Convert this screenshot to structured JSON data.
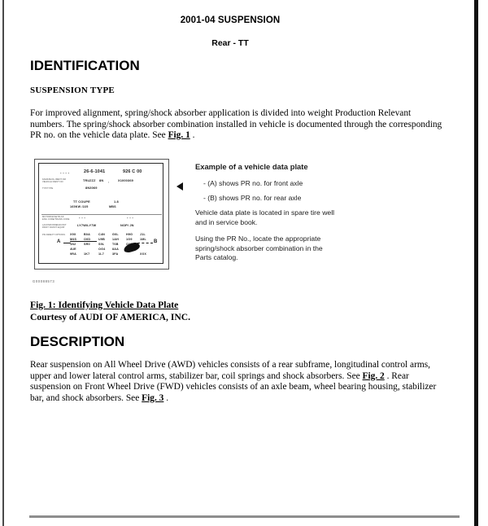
{
  "header": {
    "title": "2001-04 SUSPENSION",
    "subtitle": "Rear - TT"
  },
  "sections": {
    "identification": {
      "heading": "IDENTIFICATION",
      "subheading": "SUSPENSION TYPE",
      "body_1": "For improved alignment, spring/shock absorber application is divided into weight Production Relevant",
      "body_2": "numbers. The spring/shock absorber combination installed in vehicle is documented through the corresponding",
      "body_3_pre": "PR no. on the vehicle data plate. See ",
      "body_3_ref": "Fig. 1",
      "body_3_post": " ."
    },
    "description": {
      "heading": "DESCRIPTION",
      "body_1": "Rear suspension on All Wheel Drive (AWD) vehicles consists of a rear subframe, longitudinal control arms,",
      "body_2_pre": "upper and lower lateral control arms, stabilizer bar, coil springs and shock absorbers. See ",
      "body_2_ref": "Fig. 2",
      "body_2_post": " . Rear",
      "body_3": "suspension on Front Wheel Drive (FWD) vehicles consists of an axle beam, wheel bearing housing, stabilizer",
      "body_4_pre": "bar, and shock absorbers. See ",
      "body_4_ref": "Fig. 3",
      "body_4_post": " ."
    }
  },
  "figure": {
    "caption_line1": "Fig. 1: Identifying Vehicle Data Plate",
    "caption_line2": "Courtesy of AUDI OF AMERICA, INC.",
    "source_code": "G00088573",
    "callout": {
      "title": "Example of a vehicle data plate",
      "item_a": "-  (A) shows PR no. for front axle",
      "item_b": "-  (B) shows PR no. for rear axle",
      "note_1_line1": "Vehicle data plate is located in spare tire well",
      "note_1_line2": "and in service book.",
      "note_2_line1": "Using the PR No., locate the appropriate",
      "note_2_line2": "spring/shock  absorber combination in the",
      "note_2_line3": "Parts catalog."
    },
    "plate": {
      "row1_dashes": "-  -  -  -",
      "row1_code": "26-6-1041",
      "row1_right": "926  C  00",
      "label_1_line1": "FAHRZEUG-IDENT-NR",
      "label_1_line2": "VEHICLE IDENT NO",
      "label_2": "TYP/TYPE",
      "vin_prefix": "TRUZZZ",
      "vin_mid": "8N",
      "vin_comma": ",",
      "vin_right": "X1000369",
      "type_code": "8N3069",
      "model": "TT COUPE",
      "model_num": "1.8",
      "power": "165KW  /225",
      "power_unit": "MBS",
      "label_3_line1": "MOTORKZ/GETR-KZ",
      "label_3_line2": "ENG CODE/TRANS CODE",
      "label_4_line1": "LACKNR/INNENAUSST",
      "label_4_line2": "PAINT NO/INT EQUIP",
      "label_5": "PR-NR/EXT OPTIONS",
      "eng_dashes_left": "-  -  -",
      "eng_dashes_right": "-  -  -",
      "paint_code": "LY7W/LY7W",
      "paint_code_right": "NOP/  JN",
      "marker_a": "A",
      "marker_b": "B",
      "pr_rows": [
        [
          "X9X",
          "B0A",
          "C4N",
          "G0L",
          "H9G",
          "J1L"
        ],
        [
          "M4S",
          "O0D",
          "U9B",
          "1AH",
          "1G9",
          "1ML"
        ],
        [
          "1N2",
          "SR0",
          "S9L",
          "T6B",
          "OYZ",
          ""
        ],
        [
          "4UE",
          "",
          "OG4",
          "8AA",
          "8GD",
          ""
        ],
        [
          "9RA",
          "1K7",
          "1L7",
          "3FA",
          "XXX",
          ""
        ]
      ]
    }
  }
}
